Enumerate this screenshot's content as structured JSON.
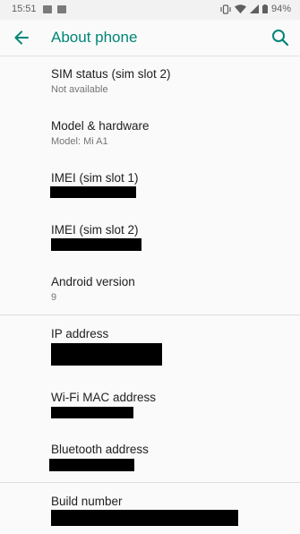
{
  "status_bar": {
    "time": "15:51",
    "battery_percent": "94%",
    "icons": [
      "image-notification-icon",
      "mail-notification-icon",
      "vibrate-icon",
      "wifi-icon",
      "signal-icon",
      "battery-icon"
    ]
  },
  "app_bar": {
    "title": "About phone",
    "back_icon": "arrow-back-icon",
    "search_icon": "search-icon",
    "accent_color": "#008577"
  },
  "items": {
    "sim_status": {
      "title": "SIM status (sim slot 2)",
      "summary": "Not available"
    },
    "model": {
      "title": "Model & hardware",
      "summary": "Model: Mi A1"
    },
    "imei1": {
      "title": "IMEI (sim slot 1)",
      "summary": "[redacted]"
    },
    "imei2": {
      "title": "IMEI (sim slot 2)",
      "summary": "[redacted]"
    },
    "android_version": {
      "title": "Android version",
      "summary": "9"
    },
    "ip_address": {
      "title": "IP address",
      "summary": "[redacted]"
    },
    "wifi_mac": {
      "title": "Wi-Fi MAC address",
      "summary": "[redacted]"
    },
    "bluetooth": {
      "title": "Bluetooth address",
      "summary": "[redacted]"
    },
    "build_number": {
      "title": "Build number",
      "summary": "[redacted]"
    }
  }
}
